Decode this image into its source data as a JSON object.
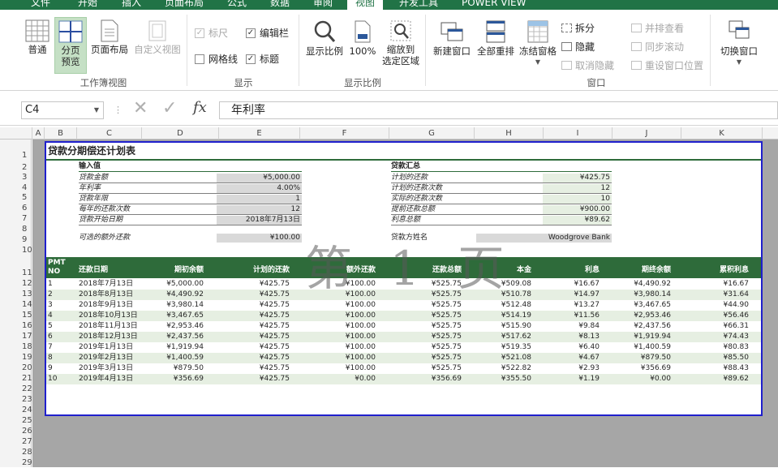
{
  "tabs": [
    "文件",
    "开始",
    "插入",
    "页面布局",
    "公式",
    "数据",
    "审阅",
    "视图",
    "开发工具",
    "POWER VIEW"
  ],
  "ribbon": {
    "normal": "普通",
    "pagebreak": [
      "分页",
      "预览"
    ],
    "pagelayout": "页面布局",
    "customview": "自定义视图",
    "workbook_views_group": "工作簿视图",
    "ruler": "标尺",
    "formula_bar": "编辑栏",
    "gridlines": "网格线",
    "headings": "标题",
    "show_group": "显示",
    "zoom": "显示比例",
    "zoom100": "100%",
    "zoom_selection": [
      "缩放到",
      "选定区域"
    ],
    "zoom_group": "显示比例",
    "new_window": "新建窗口",
    "arrange_all": "全部重排",
    "freeze_panes": "冻结窗格",
    "split": "拆分",
    "hide": "隐藏",
    "unhide": "取消隐藏",
    "view_side": "并排查看",
    "sync_scroll": "同步滚动",
    "reset_pos": "重设窗口位置",
    "switch_windows": "切换窗口",
    "window_group": "窗口"
  },
  "formula_bar": {
    "name_box": "C4",
    "fx": "fx",
    "content": "年利率"
  },
  "columns": [
    "A",
    "B",
    "C",
    "D",
    "E",
    "F",
    "G",
    "H",
    "I",
    "J",
    "K"
  ],
  "rows": [
    "1",
    "2",
    "3",
    "4",
    "5",
    "6",
    "7",
    "8",
    "9",
    "10",
    "11",
    "12",
    "13",
    "14",
    "15",
    "16",
    "17",
    "18",
    "19",
    "20",
    "21",
    "22",
    "23",
    "24",
    "25",
    "26",
    "27",
    "28",
    "29"
  ],
  "sheet": {
    "title": "贷款分期偿还计划表",
    "input_header": "输入值",
    "inputs": [
      {
        "label": "贷款金额",
        "value": "¥5,000.00"
      },
      {
        "label": "年利率",
        "value": "4.00%"
      },
      {
        "label": "贷款年限",
        "value": "1"
      },
      {
        "label": "每年的还款次数",
        "value": "12"
      },
      {
        "label": "贷款开始日期",
        "value": "2018年7月13日"
      }
    ],
    "extra_label": "可选的额外还款",
    "extra_value": "¥100.00",
    "summary_header": "贷款汇总",
    "summary": [
      {
        "label": "计划的还款",
        "value": "¥425.75"
      },
      {
        "label": "计划的还款次数",
        "value": "12"
      },
      {
        "label": "实际的还款次数",
        "value": "10"
      },
      {
        "label": "提前还款总额",
        "value": "¥900.00"
      },
      {
        "label": "利息总额",
        "value": "¥89.62"
      }
    ],
    "lender_label": "贷款方姓名",
    "lender_value": "Woodgrove Bank",
    "table_headers": [
      "PMT NO",
      "还款日期",
      "期初余额",
      "计划的还款",
      "额外还款",
      "还款总额",
      "本金",
      "利息",
      "期终余额",
      "累积利息"
    ],
    "table_rows": [
      [
        "1",
        "2018年7月13日",
        "¥5,000.00",
        "¥425.75",
        "¥100.00",
        "¥525.75",
        "¥509.08",
        "¥16.67",
        "¥4,490.92",
        "¥16.67"
      ],
      [
        "2",
        "2018年8月13日",
        "¥4,490.92",
        "¥425.75",
        "¥100.00",
        "¥525.75",
        "¥510.78",
        "¥14.97",
        "¥3,980.14",
        "¥31.64"
      ],
      [
        "3",
        "2018年9月13日",
        "¥3,980.14",
        "¥425.75",
        "¥100.00",
        "¥525.75",
        "¥512.48",
        "¥13.27",
        "¥3,467.65",
        "¥44.90"
      ],
      [
        "4",
        "2018年10月13日",
        "¥3,467.65",
        "¥425.75",
        "¥100.00",
        "¥525.75",
        "¥514.19",
        "¥11.56",
        "¥2,953.46",
        "¥56.46"
      ],
      [
        "5",
        "2018年11月13日",
        "¥2,953.46",
        "¥425.75",
        "¥100.00",
        "¥525.75",
        "¥515.90",
        "¥9.84",
        "¥2,437.56",
        "¥66.31"
      ],
      [
        "6",
        "2018年12月13日",
        "¥2,437.56",
        "¥425.75",
        "¥100.00",
        "¥525.75",
        "¥517.62",
        "¥8.13",
        "¥1,919.94",
        "¥74.43"
      ],
      [
        "7",
        "2019年1月13日",
        "¥1,919.94",
        "¥425.75",
        "¥100.00",
        "¥525.75",
        "¥519.35",
        "¥6.40",
        "¥1,400.59",
        "¥80.83"
      ],
      [
        "8",
        "2019年2月13日",
        "¥1,400.59",
        "¥425.75",
        "¥100.00",
        "¥525.75",
        "¥521.08",
        "¥4.67",
        "¥879.50",
        "¥85.50"
      ],
      [
        "9",
        "2019年3月13日",
        "¥879.50",
        "¥425.75",
        "¥100.00",
        "¥525.75",
        "¥522.82",
        "¥2.93",
        "¥356.69",
        "¥88.43"
      ],
      [
        "10",
        "2019年4月13日",
        "¥356.69",
        "¥425.75",
        "¥0.00",
        "¥356.69",
        "¥355.50",
        "¥1.19",
        "¥0.00",
        "¥89.62"
      ]
    ]
  },
  "watermark": "第 1 页",
  "colors": {
    "accent": "#217346",
    "table_header": "#2e6b3a",
    "row_alt": "#e6efe2",
    "page_border": "#1f1fcc"
  }
}
